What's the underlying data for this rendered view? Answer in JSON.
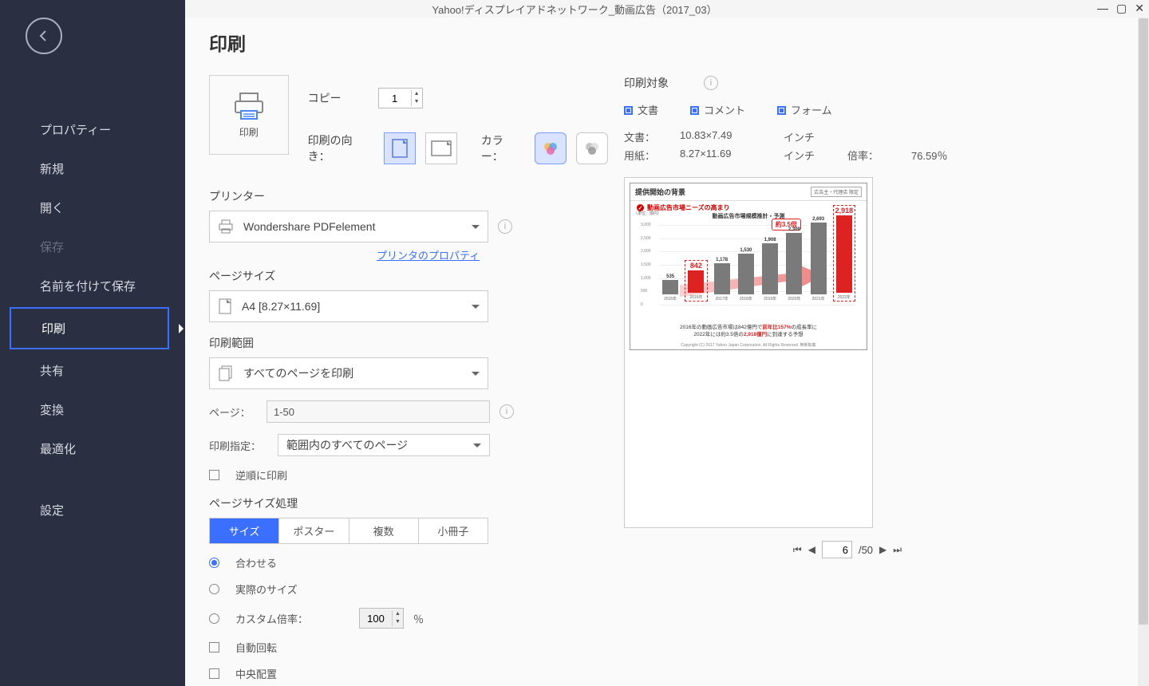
{
  "window": {
    "title": "Yahoo!ディスプレイアドネットワーク_動画広告（2017_03）"
  },
  "sidebar": {
    "items": [
      {
        "label": "プロパティー"
      },
      {
        "label": "新規"
      },
      {
        "label": "開く"
      },
      {
        "label": "保存",
        "disabled": true
      },
      {
        "label": "名前を付けて保存"
      },
      {
        "label": "印刷",
        "active": true
      },
      {
        "label": "共有"
      },
      {
        "label": "変換"
      },
      {
        "label": "最適化"
      },
      {
        "label": "設定",
        "sep": true
      }
    ]
  },
  "page_title": "印刷",
  "print_box_label": "印刷",
  "copy_label": "コピー",
  "copy_value": "1",
  "orientation_label": "印刷の向き：",
  "color_label": "カラー：",
  "printer_section": "プリンター",
  "printer_value": "Wondershare PDFelement",
  "printer_props_link": "プリンタのプロパティ",
  "pagesize_section": "ページサイズ",
  "pagesize_value": "A4 [8.27×11.69]",
  "range_section": "印刷範囲",
  "range_value": "すべてのページを印刷",
  "page_label": "ページ：",
  "page_value": "1-50",
  "subset_label": "印刷指定：",
  "subset_value": "範囲内のすべてのページ",
  "reverse_label": "逆順に印刷",
  "handling_section": "ページサイズ処理",
  "tabs": [
    "サイズ",
    "ポスター",
    "複数",
    "小冊子"
  ],
  "fit_options": {
    "fit": "合わせる",
    "actual": "実際のサイズ",
    "custom": "カスタム倍率："
  },
  "custom_scale_value": "100",
  "percent": "％",
  "autorotate": "自動回転",
  "center": "中央配置",
  "target_label": "印刷対象",
  "target_doc": "文書",
  "target_comment": "コメント",
  "target_form": "フォーム",
  "info": {
    "doc_label": "文書：",
    "doc_size": "10.83×7.49",
    "doc_unit": "インチ",
    "paper_label": "用紙：",
    "paper_size": "8.27×11.69",
    "paper_unit": "インチ",
    "scale_label": "倍率：",
    "scale_value": "76.59％"
  },
  "pager": {
    "current": "6",
    "total": "/50"
  },
  "slide": {
    "header": "提供開始の背景",
    "badge": "広告主・代理店\n限定",
    "subtitle": "動画広告市場ニーズの高まり",
    "chart_title": "動画広告市場規模推計・予測",
    "yaxis": "（単位：億円）",
    "callout": "約3.5倍",
    "footer_1": "2016年の動画広告市場は842億円で",
    "footer_em1": "前年比157%",
    "footer_2": "の成長率に",
    "footer_3": "2022年には約3.5倍の",
    "footer_em2": "2,918億円",
    "footer_4": "に到達する予想",
    "copyright": "Copyright (C) 2017 Yahoo Japan Corporation. All Rights Reserved. 無断転載"
  },
  "chart_data": {
    "type": "bar",
    "title": "動画広告市場規模推計・予測",
    "ylabel": "（単位：億円）",
    "ylim": [
      0,
      3000
    ],
    "yticks": [
      0,
      500,
      1000,
      1500,
      2000,
      2500,
      3000
    ],
    "categories": [
      "2015年",
      "2016年",
      "2017年",
      "2018年",
      "2019年",
      "2020年",
      "2021年",
      "2022年"
    ],
    "values": [
      535,
      842,
      1178,
      1530,
      1908,
      2309,
      2693,
      2918
    ],
    "highlight_indices": [
      1,
      7
    ],
    "callout": "約3.5倍"
  }
}
